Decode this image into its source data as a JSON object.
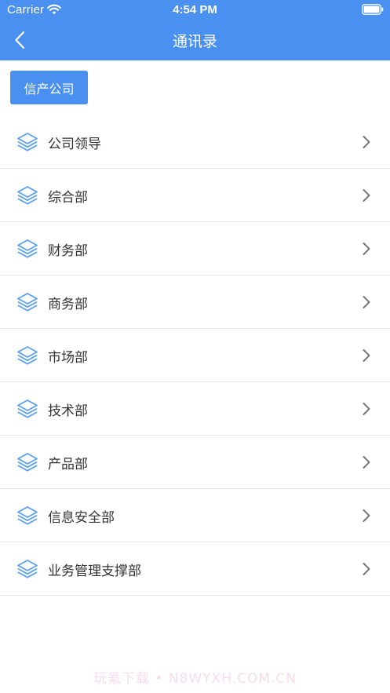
{
  "status_bar": {
    "carrier": "Carrier",
    "time": "4:54 PM"
  },
  "nav": {
    "title": "通讯录",
    "back_icon": "chevron-left-icon"
  },
  "company_button": {
    "label": "信产公司"
  },
  "departments": [
    {
      "label": "公司领导"
    },
    {
      "label": "综合部"
    },
    {
      "label": "财务部"
    },
    {
      "label": "商务部"
    },
    {
      "label": "市场部"
    },
    {
      "label": "技术部"
    },
    {
      "label": "产品部"
    },
    {
      "label": "信息安全部"
    },
    {
      "label": "业务管理支撑部"
    }
  ],
  "watermark": {
    "text": "玩氪下载 • N8WYXH.COM.CN"
  },
  "colors": {
    "primary": "#4a90f0",
    "icon": "#5ca0f2",
    "text": "#333333",
    "chevron": "#777777",
    "divider": "#e6e6e6"
  }
}
